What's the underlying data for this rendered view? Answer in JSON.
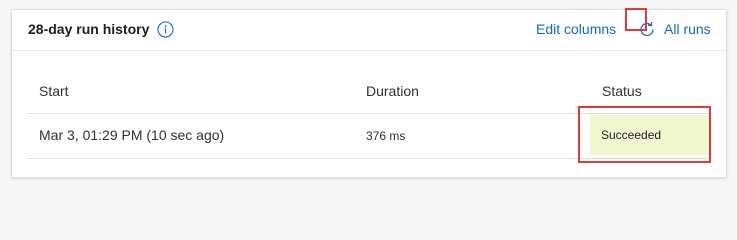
{
  "header": {
    "title": "28-day run history",
    "info_icon": "info-icon",
    "edit_columns_label": "Edit columns",
    "refresh_icon": "refresh-icon",
    "all_runs_label": "All runs"
  },
  "table": {
    "columns": [
      "Start",
      "Duration",
      "Status"
    ],
    "rows": [
      {
        "start": "Mar 3, 01:29 PM (10 sec ago)",
        "duration": "376 ms",
        "status": "Succeeded"
      }
    ]
  },
  "colors": {
    "link": "#0f6cbd",
    "highlight_box": "#e0393e",
    "status_success_bg": "#f1f8cf"
  }
}
